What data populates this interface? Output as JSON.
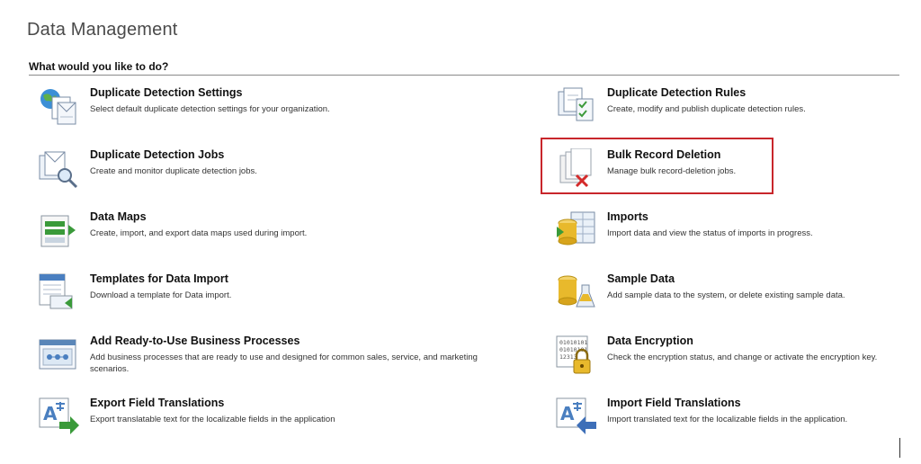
{
  "page": {
    "title": "Data Management",
    "section_header": "What would you like to do?"
  },
  "tasks": [
    {
      "title": "Duplicate Detection Settings",
      "description": "Select default duplicate detection settings for your organization.",
      "icon": "duplicate-detection-settings-icon"
    },
    {
      "title": "Duplicate Detection Rules",
      "description": "Create, modify and publish duplicate detection rules.",
      "icon": "duplicate-detection-rules-icon"
    },
    {
      "title": "Duplicate Detection Jobs",
      "description": "Create and monitor duplicate detection jobs.",
      "icon": "duplicate-detection-jobs-icon"
    },
    {
      "title": "Bulk Record Deletion",
      "description": "Manage bulk record-deletion jobs.",
      "icon": "bulk-record-deletion-icon",
      "highlighted": true
    },
    {
      "title": "Data Maps",
      "description": "Create, import, and export data maps used during import.",
      "icon": "data-maps-icon"
    },
    {
      "title": "Imports",
      "description": "Import data and view the status of imports in progress.",
      "icon": "imports-icon"
    },
    {
      "title": "Templates for Data Import",
      "description": "Download a template for Data import.",
      "icon": "templates-icon"
    },
    {
      "title": "Sample Data",
      "description": "Add sample data to the system, or delete existing sample data.",
      "icon": "sample-data-icon"
    },
    {
      "title": "Add Ready-to-Use Business Processes",
      "description": "Add business processes that are ready to use and designed for common sales, service, and marketing scenarios.",
      "icon": "business-processes-icon"
    },
    {
      "title": "Data Encryption",
      "description": "Check the encryption status, and change or activate the encryption key.",
      "icon": "data-encryption-icon",
      "icon_text": [
        "01010101",
        "01010101",
        "12313"
      ]
    },
    {
      "title": "Export Field Translations",
      "description": "Export translatable text for the localizable fields in the application",
      "icon": "export-translations-icon"
    },
    {
      "title": "Import Field Translations",
      "description": "Import translated text for the localizable fields in the application.",
      "icon": "import-translations-icon"
    }
  ],
  "colors": {
    "highlight": "#c8262b",
    "title_gray": "#4a4a4a",
    "rule_gray": "#8a8a8a"
  }
}
